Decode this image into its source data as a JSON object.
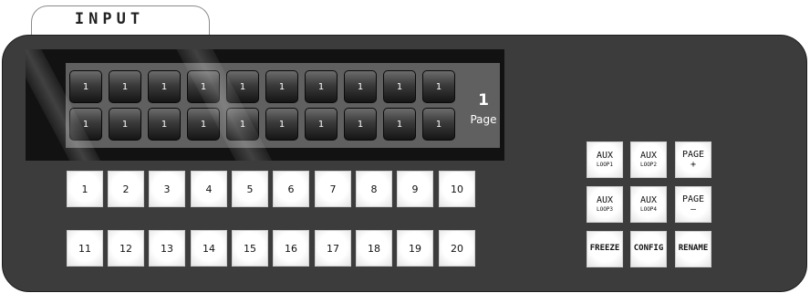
{
  "tab": {
    "label": "INPUT"
  },
  "lcd": {
    "row1": [
      "1",
      "1",
      "1",
      "1",
      "1",
      "1",
      "1",
      "1",
      "1",
      "1"
    ],
    "row2": [
      "1",
      "1",
      "1",
      "1",
      "1",
      "1",
      "1",
      "1",
      "1",
      "1"
    ],
    "page_number": "1",
    "page_label": "Page"
  },
  "keys": {
    "row1": [
      "1",
      "2",
      "3",
      "4",
      "5",
      "6",
      "7",
      "8",
      "9",
      "10"
    ],
    "row2": [
      "11",
      "12",
      "13",
      "14",
      "15",
      "16",
      "17",
      "18",
      "19",
      "20"
    ]
  },
  "functions": {
    "aux_loop1": {
      "line1": "AUX",
      "line2": "LOOP1"
    },
    "aux_loop2": {
      "line1": "AUX",
      "line2": "LOOP2"
    },
    "page_plus": {
      "line1": "PAGE",
      "line2": "+"
    },
    "aux_loop3": {
      "line1": "AUX",
      "line2": "LOOP3"
    },
    "aux_loop4": {
      "line1": "AUX",
      "line2": "LOOP4"
    },
    "page_minus": {
      "line1": "PAGE",
      "line2": "–"
    },
    "freeze": "FREEZE",
    "config": "CONFIG",
    "rename": "RENAME"
  }
}
